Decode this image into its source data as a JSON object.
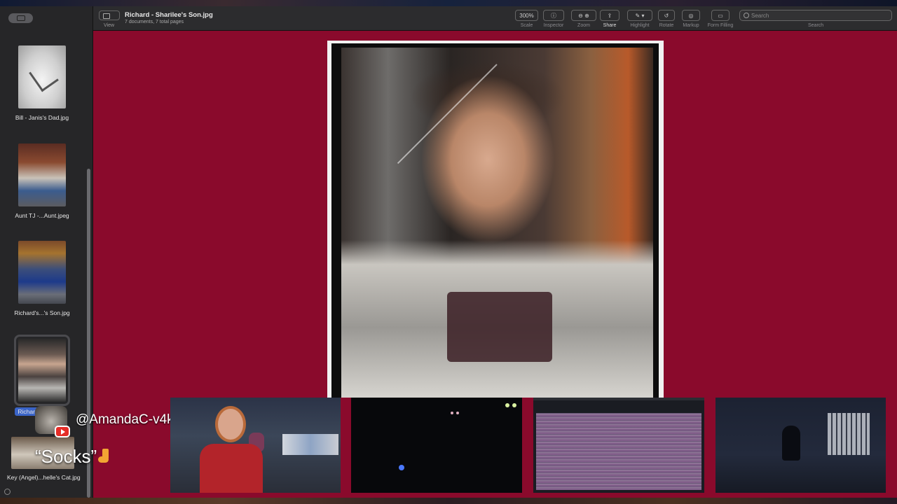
{
  "window": {
    "title": "Richard - Sharilee's Son.jpg",
    "subtitle": "7 documents, 7 total pages"
  },
  "toolbar": {
    "view_label": "View",
    "scale_value": "300%",
    "labels": {
      "scale": "Scale",
      "inspector": "Inspector",
      "zoom": "Zoom",
      "share": "Share",
      "highlight": "Highlight",
      "rotate": "Rotate",
      "markup": "Markup",
      "form_filling": "Form Filling",
      "search": "Search"
    },
    "search_placeholder": "Search"
  },
  "sidebar": {
    "items": [
      {
        "label": "Bill - Janis's Dad.jpg"
      },
      {
        "label": "Aunt TJ -...Aunt.jpeg"
      },
      {
        "label": "Richard's...'s Son.jpg"
      },
      {
        "label": "Richard"
      }
    ],
    "partial_item": {
      "label": "Key (Angel)...helle's Cat.jpg"
    }
  },
  "overlay": {
    "handle": "@AmandaC-v4k",
    "caption": "“Socks”"
  },
  "icons": [
    "sidebar-toggle-icon",
    "view-icon",
    "inspector-icon",
    "zoom-out-icon",
    "zoom-in-icon",
    "share-icon",
    "highlight-icon",
    "rotate-icon",
    "markup-icon",
    "form-filling-icon",
    "search-icon",
    "youtube-icon",
    "sock-icon"
  ],
  "colors": {
    "main_background": "#8a0a2c",
    "sidebar_background": "#262628",
    "toolbar_background": "#2c2c2e",
    "selection": "#3a64c8"
  }
}
